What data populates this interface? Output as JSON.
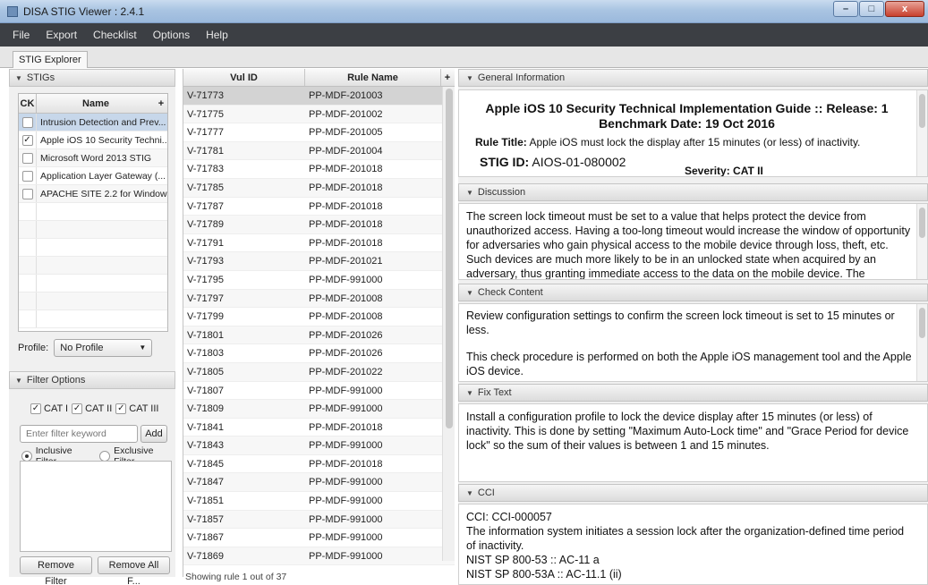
{
  "window": {
    "title": "DISA STIG Viewer : 2.4.1",
    "minimize": "–",
    "maximize": "□",
    "close": "x"
  },
  "menu": [
    "File",
    "Export",
    "Checklist",
    "Options",
    "Help"
  ],
  "tab": "STIG Explorer",
  "stigs": {
    "header": "STIGs",
    "col_ck": "CK",
    "col_name": "Name",
    "col_add": "+",
    "rows": [
      {
        "name": "Intrusion Detection and Prev...",
        "checked": false,
        "selected": true
      },
      {
        "name": "Apple iOS 10 Security Techni...",
        "checked": true,
        "selected": false
      },
      {
        "name": "Microsoft Word 2013 STIG",
        "checked": false,
        "selected": false
      },
      {
        "name": "Application Layer Gateway (...",
        "checked": false,
        "selected": false
      },
      {
        "name": "APACHE SITE 2.2 for Windows",
        "checked": false,
        "selected": false
      }
    ],
    "profile_label": "Profile:",
    "profile_value": "No Profile"
  },
  "filter": {
    "header": "Filter Options",
    "cat1": "CAT I",
    "cat2": "CAT II",
    "cat3": "CAT III",
    "keyword_placeholder": "Enter filter keyword",
    "add": "Add",
    "inclusive": "Inclusive Filter",
    "exclusive": "Exclusive Filter",
    "remove": "Remove Filter",
    "remove_all": "Remove All F..."
  },
  "rules": {
    "col_vul": "Vul ID",
    "col_rule": "Rule Name",
    "col_add": "+",
    "rows": [
      [
        "V-71773",
        "PP-MDF-201003"
      ],
      [
        "V-71775",
        "PP-MDF-201002"
      ],
      [
        "V-71777",
        "PP-MDF-201005"
      ],
      [
        "V-71781",
        "PP-MDF-201004"
      ],
      [
        "V-71783",
        "PP-MDF-201018"
      ],
      [
        "V-71785",
        "PP-MDF-201018"
      ],
      [
        "V-71787",
        "PP-MDF-201018"
      ],
      [
        "V-71789",
        "PP-MDF-201018"
      ],
      [
        "V-71791",
        "PP-MDF-201018"
      ],
      [
        "V-71793",
        "PP-MDF-201021"
      ],
      [
        "V-71795",
        "PP-MDF-991000"
      ],
      [
        "V-71797",
        "PP-MDF-201008"
      ],
      [
        "V-71799",
        "PP-MDF-201008"
      ],
      [
        "V-71801",
        "PP-MDF-201026"
      ],
      [
        "V-71803",
        "PP-MDF-201026"
      ],
      [
        "V-71805",
        "PP-MDF-201022"
      ],
      [
        "V-71807",
        "PP-MDF-991000"
      ],
      [
        "V-71809",
        "PP-MDF-991000"
      ],
      [
        "V-71841",
        "PP-MDF-201018"
      ],
      [
        "V-71843",
        "PP-MDF-991000"
      ],
      [
        "V-71845",
        "PP-MDF-201018"
      ],
      [
        "V-71847",
        "PP-MDF-991000"
      ],
      [
        "V-71851",
        "PP-MDF-991000"
      ],
      [
        "V-71857",
        "PP-MDF-991000"
      ],
      [
        "V-71867",
        "PP-MDF-991000"
      ],
      [
        "V-71869",
        "PP-MDF-991000"
      ]
    ],
    "status": "Showing rule 1 out of 37"
  },
  "general": {
    "header": "General Information",
    "title": "Apple iOS 10 Security Technical Implementation Guide :: Release: 1 Benchmark Date: 19 Oct 2016",
    "rule_title_label": "Rule Title:",
    "rule_title": "Apple iOS must lock the display after 15 minutes (or less) of inactivity.",
    "stig_id_label": "STIG ID:",
    "stig_id": "AIOS-01-080002",
    "severity": "Severity: CAT II"
  },
  "discussion": {
    "header": "Discussion",
    "text": "The screen lock timeout must be set to a value that helps protect the device from unauthorized access. Having a too-long timeout would increase the window of opportunity for adversaries who gain physical access to the mobile device through loss, theft, etc. Such devices are much more likely to be in an unlocked state when acquired by an adversary, thus granting immediate access to the data on the mobile device. The maximum timeout"
  },
  "check": {
    "header": "Check Content",
    "p1": "Review configuration settings to confirm the screen lock timeout is set to 15 minutes or less.",
    "p2": "This check procedure is performed on both the Apple iOS management tool and the Apple iOS device."
  },
  "fix": {
    "header": "Fix Text",
    "text": "Install a configuration profile to lock the device display after 15 minutes (or less) of inactivity. This is done by setting \"Maximum Auto-Lock time\" and \"Grace Period for device lock\" so the sum of their values is between 1 and 15 minutes."
  },
  "cci": {
    "header": "CCI",
    "l1": "CCI: CCI-000057",
    "l2": "The information system initiates a session lock after the organization-defined time period of inactivity.",
    "l3": "NIST SP 800-53 :: AC-11 a",
    "l4": "NIST SP 800-53A :: AC-11.1 (ii)"
  }
}
